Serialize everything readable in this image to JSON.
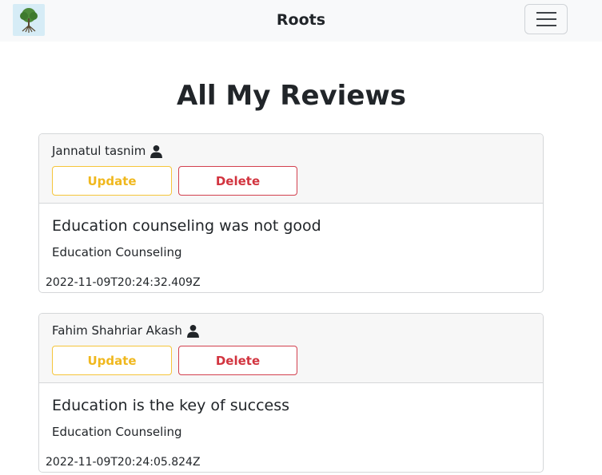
{
  "nav": {
    "brand": "Roots",
    "logo_icon": "tree-logo-icon",
    "menu_icon": "hamburger-menu-icon"
  },
  "page_title": "All My Reviews",
  "reviews": [
    {
      "author": "Jannatul tasnim",
      "update_label": "Update",
      "delete_label": "Delete",
      "title": "Education counseling was not good",
      "service": "Education Counseling",
      "date": "2022-11-09T20:24:32.409Z"
    },
    {
      "author": "Fahim Shahriar Akash",
      "update_label": "Update",
      "delete_label": "Delete",
      "title": "Education is the key of success",
      "service": "Education Counseling",
      "date": "2022-11-09T20:24:05.824Z"
    }
  ],
  "colors": {
    "warning": "#f0b81e",
    "danger": "#d2343f",
    "navbar_bg": "#f8f9fa"
  }
}
